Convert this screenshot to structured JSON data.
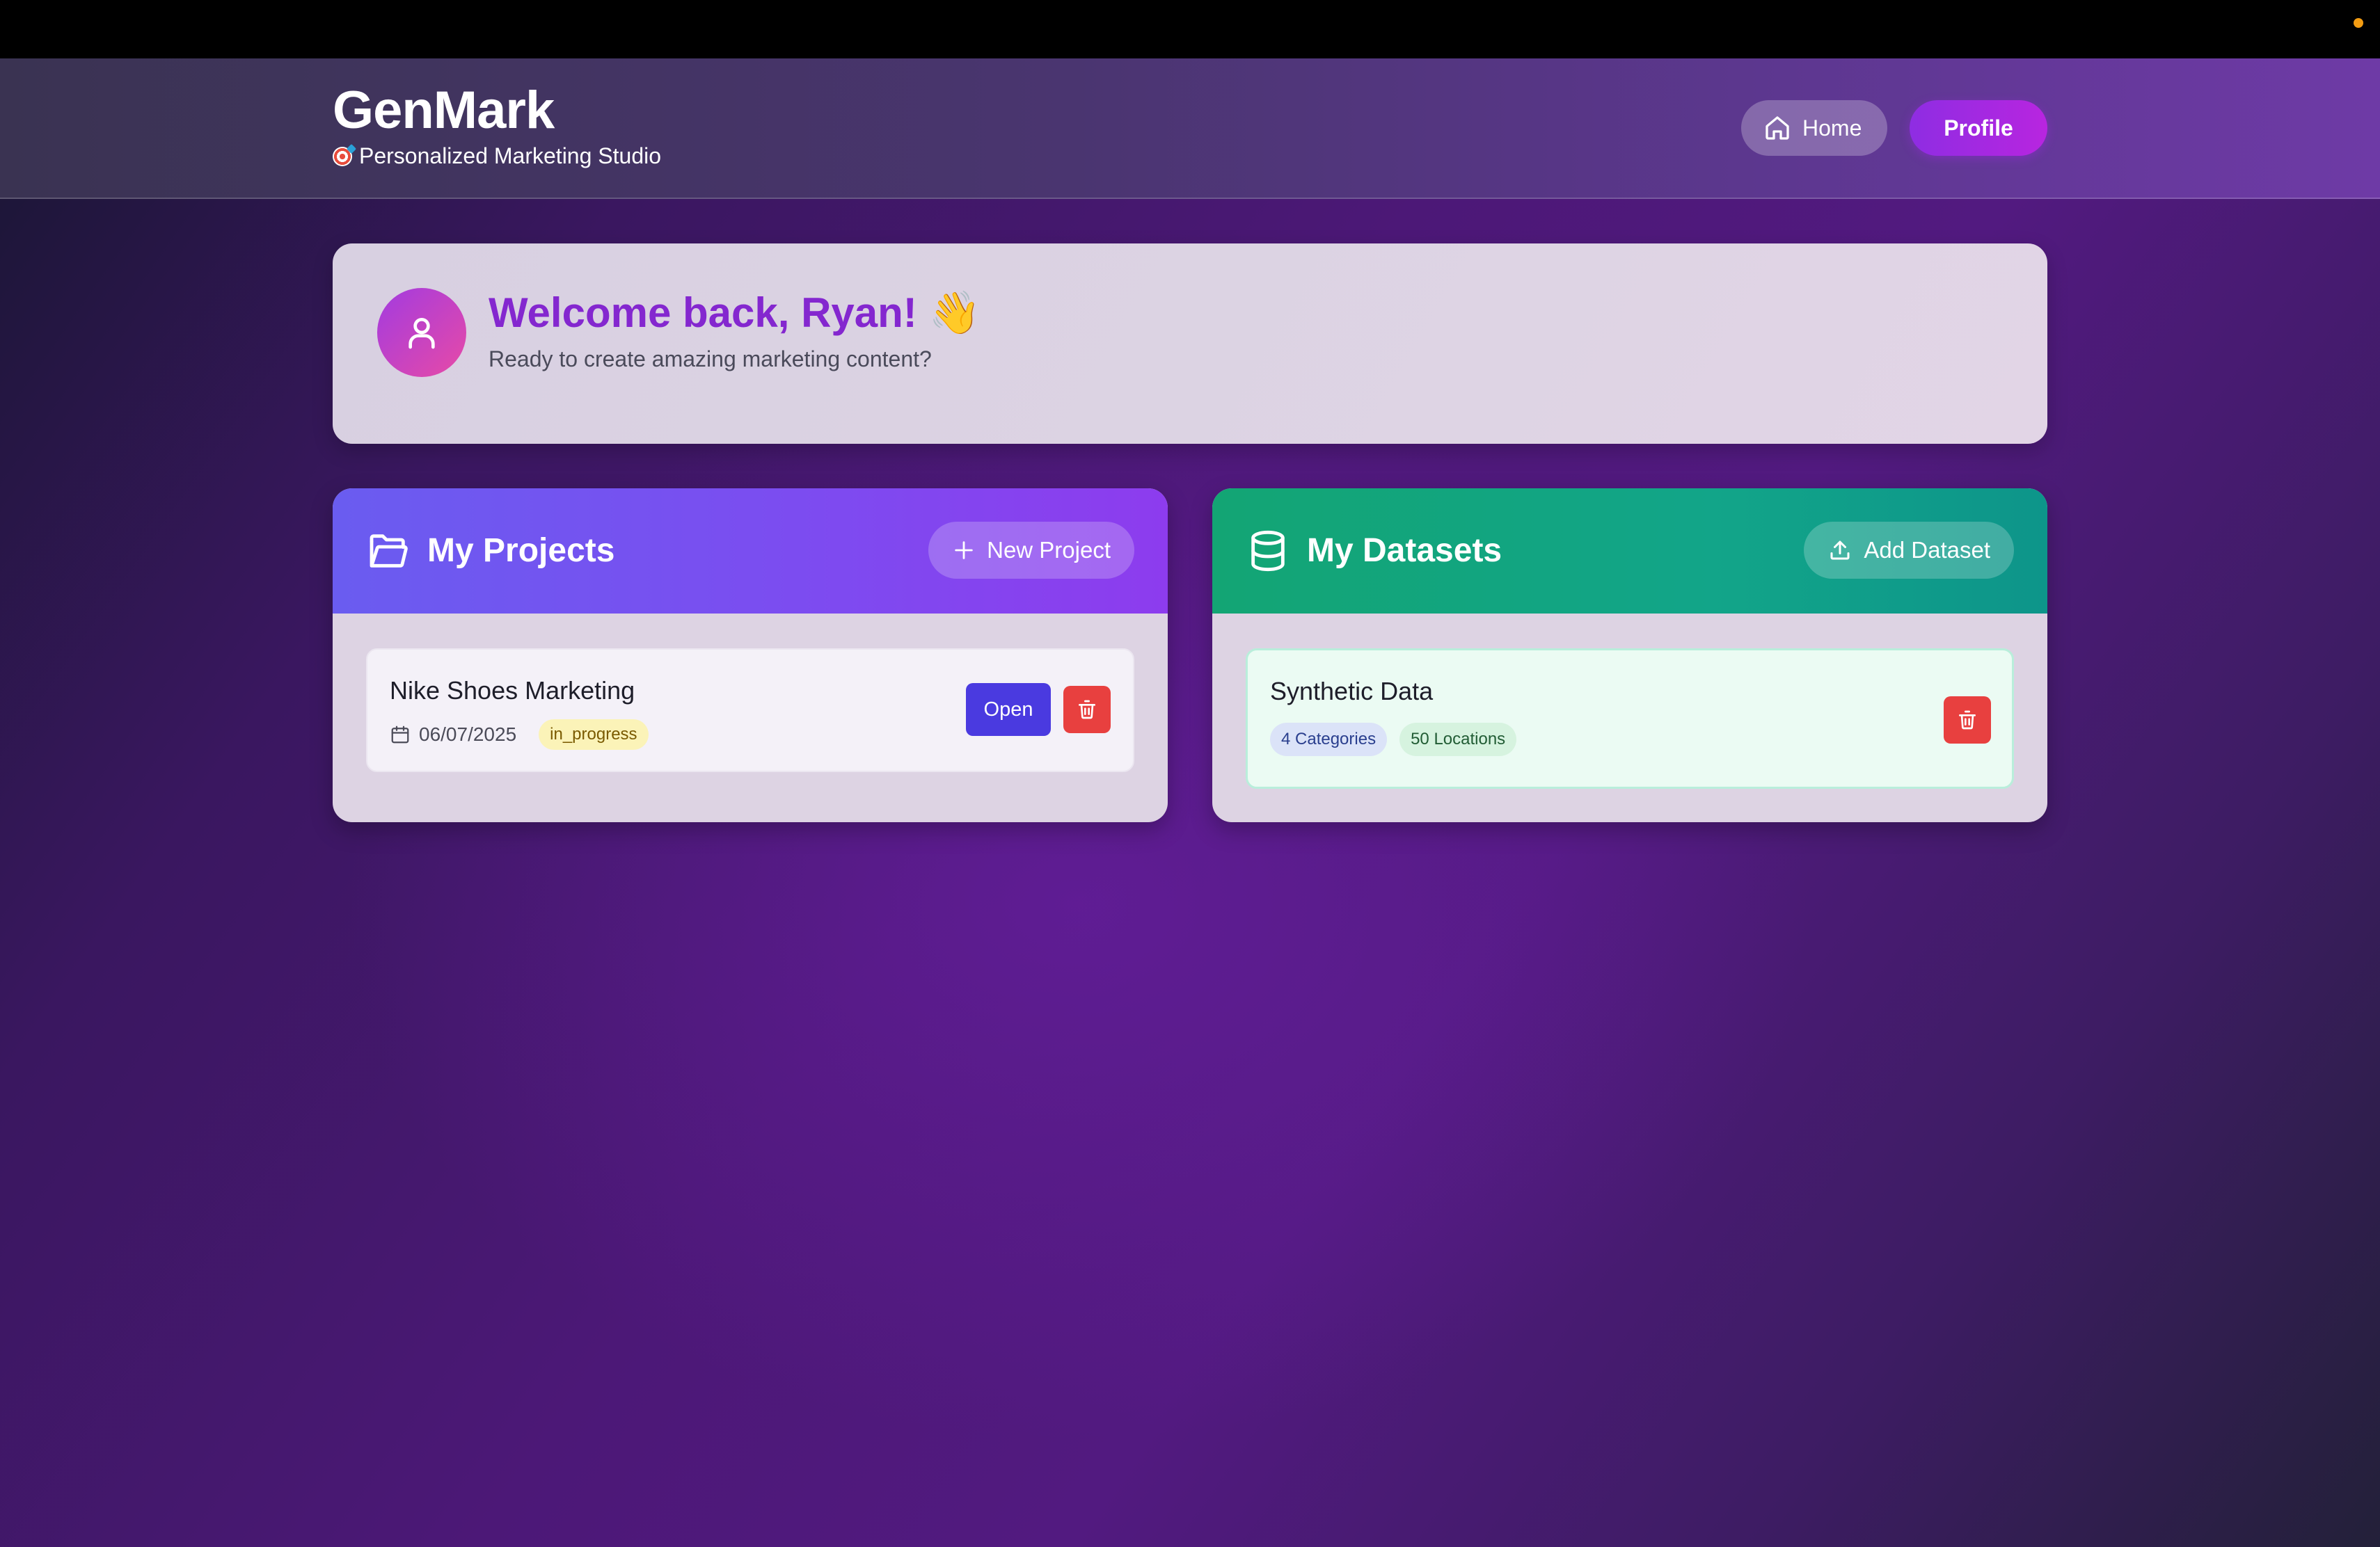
{
  "app": {
    "title": "GenMark",
    "subtitle": "Personalized Marketing Studio"
  },
  "nav": {
    "home_label": "Home",
    "profile_label": "Profile"
  },
  "welcome": {
    "title": "Welcome back, Ryan! 👋",
    "subtitle": "Ready to create amazing marketing content?"
  },
  "projects": {
    "title": "My Projects",
    "action_label": "New Project",
    "items": [
      {
        "name": "Nike Shoes Marketing",
        "date": "06/07/2025",
        "status": "in_progress",
        "open_label": "Open"
      }
    ]
  },
  "datasets": {
    "title": "My Datasets",
    "action_label": "Add Dataset",
    "items": [
      {
        "name": "Synthetic Data",
        "categories": "4 Categories",
        "locations": "50 Locations"
      }
    ]
  },
  "colors": {
    "accent_purple": "#8427cf",
    "open_button": "#4a3ae0",
    "delete_button": "#e8403f",
    "datasets_header": "#13a574"
  }
}
